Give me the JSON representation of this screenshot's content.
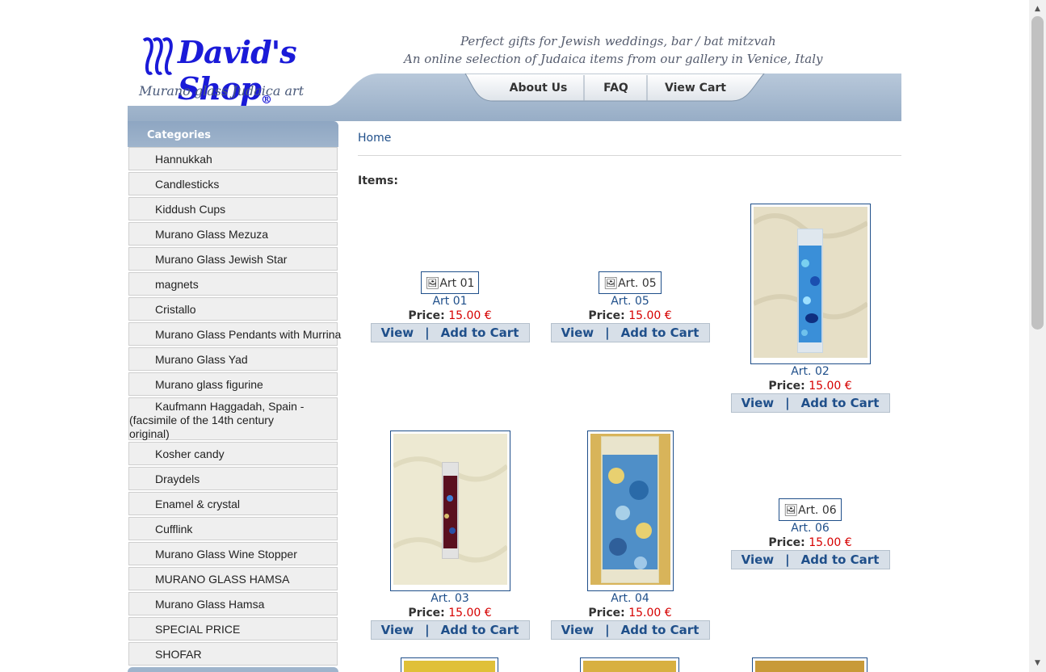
{
  "header": {
    "logo_title": "David's Shop",
    "logo_reg": "®",
    "logo_subtitle": "Murano glass Judaica art",
    "tagline_1": "Perfect gifts for Jewish weddings, bar / bat mitzvah",
    "tagline_2": "An online selection of Judaica items from our gallery in Venice, Italy",
    "nav": [
      "About Us",
      "FAQ",
      "View Cart"
    ]
  },
  "sidebar": {
    "heading": "Categories",
    "items": [
      "Hannukkah",
      "Candlesticks",
      "Kiddush Cups",
      "Murano Glass Mezuza",
      "Murano Glass Jewish Star",
      "magnets",
      "Cristallo",
      "Murano Glass Pendants with Murrina",
      "Murano Glass Yad",
      "Murano glass figurine",
      "Kaufmann Haggadah, Spain - (facsimile of the 14th century original)",
      "Kosher candy",
      "Draydels",
      "Enamel & crystal",
      "Cufflink",
      "Murano Glass Wine Stopper",
      "MURANO GLASS HAMSA",
      "Murano Glass Hamsa",
      "SPECIAL PRICE",
      "SHOFAR"
    ]
  },
  "main": {
    "breadcrumb": "Home",
    "items_label": "Items:",
    "price_label": "Price:",
    "view_label": "View",
    "add_label": "Add to Cart",
    "separator": "|",
    "items": [
      {
        "name": "Art 01",
        "alt": "Art 01",
        "price": "15.00 €"
      },
      {
        "name": "Art. 05",
        "alt": "Art. 05",
        "price": "15.00 €"
      },
      {
        "name": "Art. 02",
        "alt": "Art. 02",
        "price": "15.00 €"
      },
      {
        "name": "Art. 03",
        "alt": "Art. 03",
        "price": "15.00 €"
      },
      {
        "name": "Art. 04",
        "alt": "Art. 04",
        "price": "15.00 €"
      },
      {
        "name": "Art. 06",
        "alt": "Art. 06",
        "price": "15.00 €"
      }
    ]
  },
  "colors": {
    "link_blue": "#1f4f8a",
    "price_red": "#d60000",
    "header_bar": "#9fb4cc",
    "sidebar_item_bg": "#efefef"
  }
}
